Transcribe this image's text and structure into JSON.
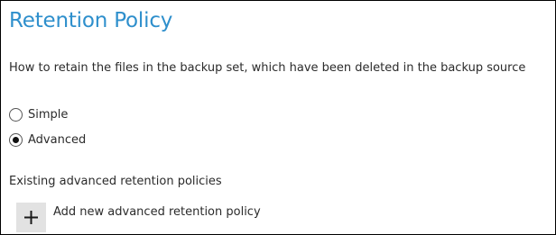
{
  "section": {
    "title": "Retention Policy",
    "description": "How to retain the files in the backup set, which have been deleted in the backup source"
  },
  "retention_type": {
    "options": [
      {
        "label": "Simple",
        "selected": false
      },
      {
        "label": "Advanced",
        "selected": true
      }
    ]
  },
  "advanced_policies": {
    "heading": "Existing advanced retention policies",
    "add_label": "Add new advanced retention policy",
    "add_icon": "plus-icon"
  },
  "colors": {
    "title": "#2e8fcc",
    "text": "#2b2b2b",
    "button_bg": "#e2e2e2"
  }
}
